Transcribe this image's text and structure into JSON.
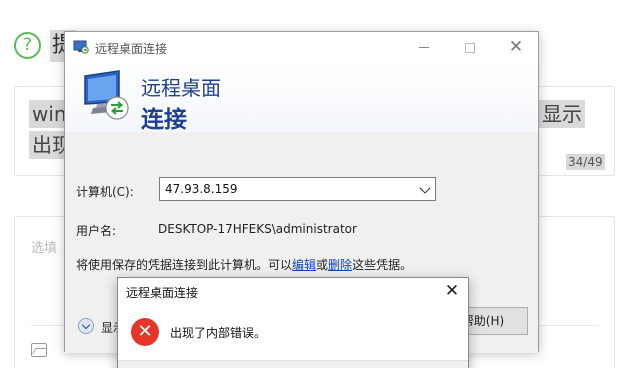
{
  "background_page": {
    "help_icon_glyph": "?",
    "title_fragment": "提",
    "line1_left": "win",
    "line1_right": "显示",
    "line2_left": "出现",
    "counter": "34/49",
    "placeholder": "选填"
  },
  "rdp_window": {
    "title": "远程桌面连接",
    "header_line1": "远程桌面",
    "header_line2": "连接",
    "computer_label": "计算机(C):",
    "computer_value": "47.93.8.159",
    "user_label": "用户名:",
    "user_value": "DESKTOP-17HFEKS\\administrator",
    "cred_note_prefix": "将使用保存的凭据连接到此计算机。可以",
    "edit_link": "编辑",
    "cred_note_or": "或",
    "delete_link": "删除",
    "cred_note_suffix": "这些凭据。",
    "show_options_label": "显示",
    "help_button_label": "帮助(H)"
  },
  "error_dialog": {
    "title": "远程桌面连接",
    "close_glyph": "✕",
    "icon_glyph": "✕",
    "message": "出现了内部错误。"
  },
  "colors": {
    "accent_blue": "#1f3f8f",
    "link_blue": "#0645c5",
    "error_red": "#e5342a",
    "help_green": "#5cb85c"
  }
}
